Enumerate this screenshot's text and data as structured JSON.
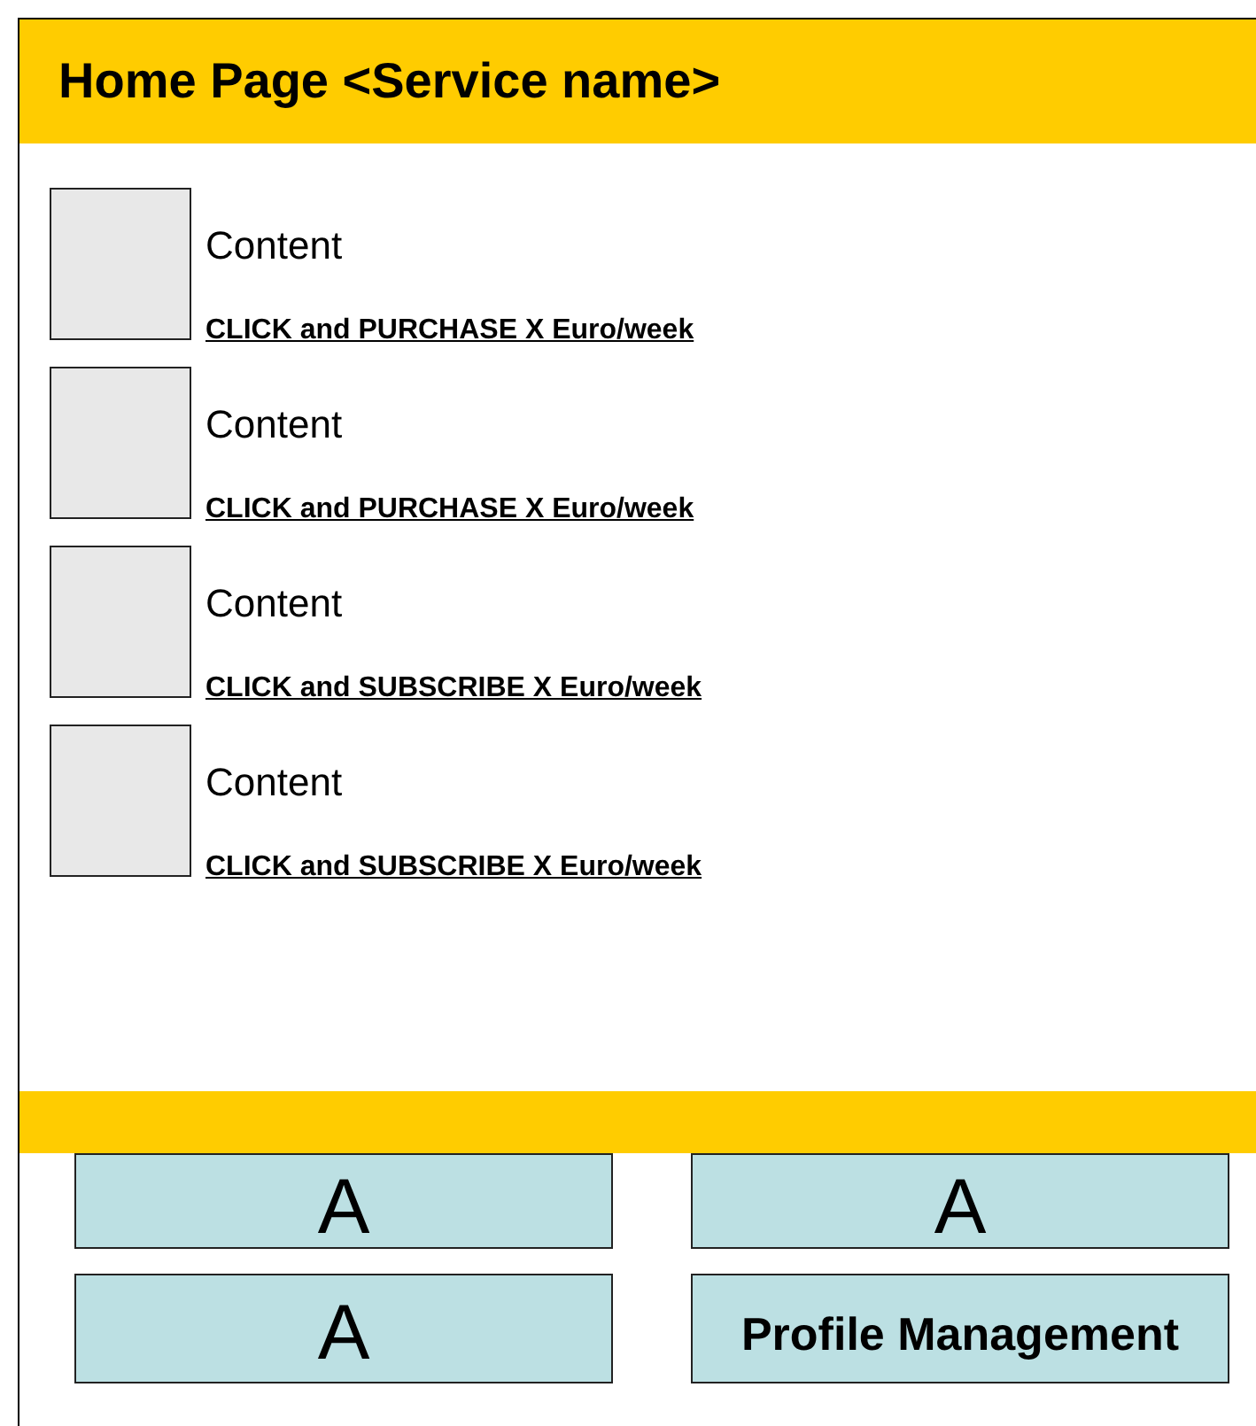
{
  "header": {
    "title": "Home Page <Service name>"
  },
  "items": [
    {
      "content": "Content",
      "link": "CLICK and PURCHASE X Euro/week"
    },
    {
      "content": "Content",
      "link": "CLICK and PURCHASE X Euro/week"
    },
    {
      "content": "Content",
      "link": "CLICK and SUBSCRIBE X Euro/week"
    },
    {
      "content": "Content",
      "link": "CLICK and SUBSCRIBE X Euro/week"
    }
  ],
  "buttons": [
    {
      "label": "A",
      "kind": "letter"
    },
    {
      "label": "A",
      "kind": "letter"
    },
    {
      "label": "A",
      "kind": "letter"
    },
    {
      "label": "Profile Management",
      "kind": "text"
    }
  ]
}
